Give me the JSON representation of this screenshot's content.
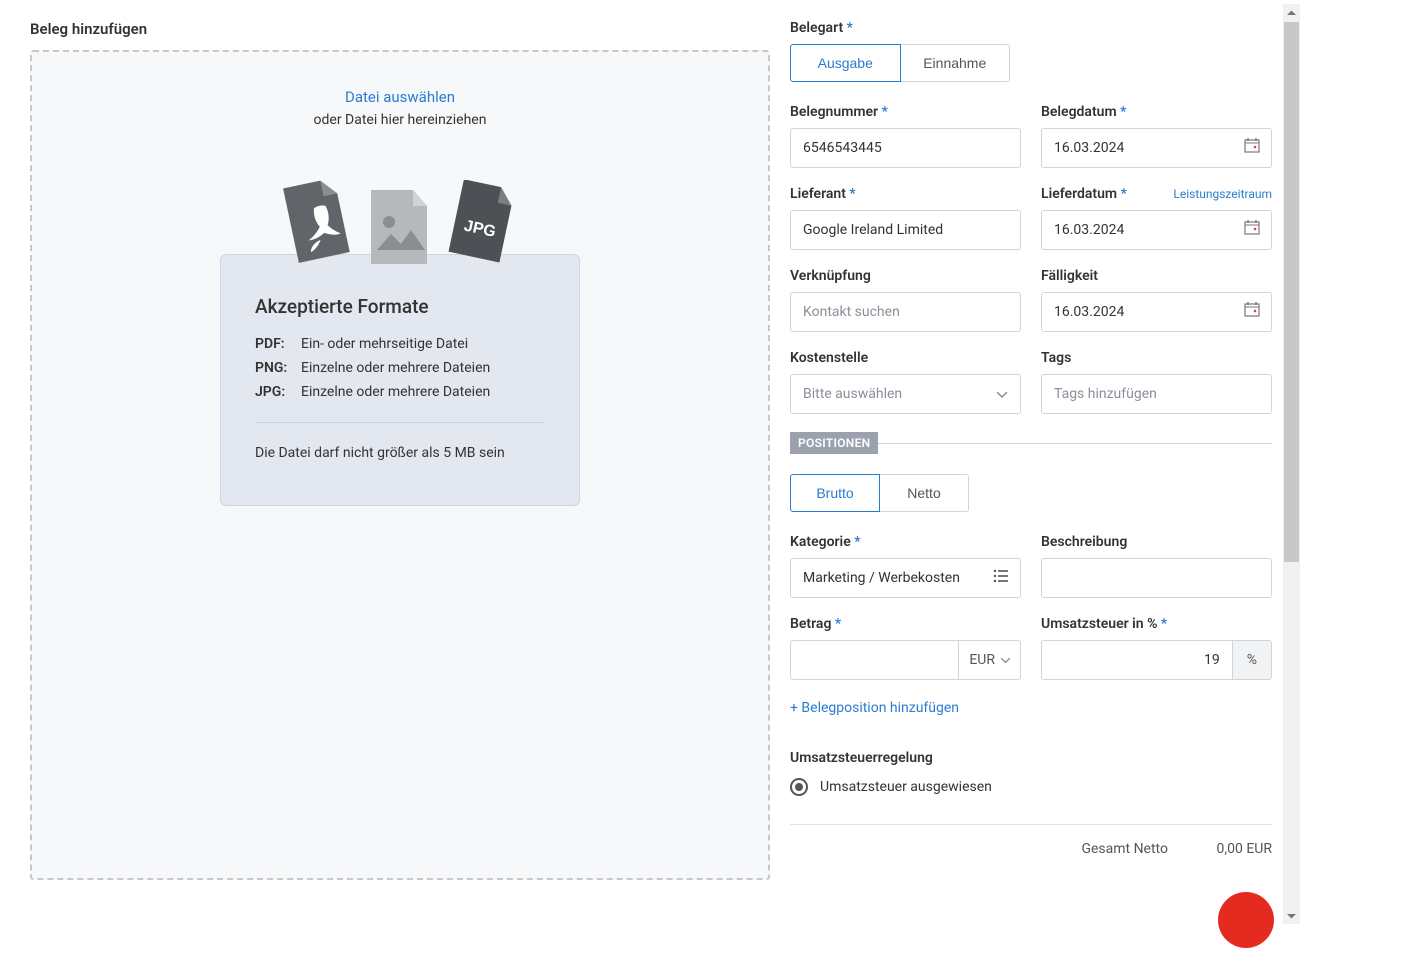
{
  "left": {
    "title": "Beleg hinzufügen",
    "select_file": "Datei auswählen",
    "drag_text": "oder Datei hier hereinziehen",
    "formats_title": "Akzeptierte Formate",
    "formats": [
      {
        "label": "PDF:",
        "desc": "Ein- oder mehrseitige Datei"
      },
      {
        "label": "PNG:",
        "desc": "Einzelne oder mehrere Dateien"
      },
      {
        "label": "JPG:",
        "desc": "Einzelne oder mehrere Dateien"
      }
    ],
    "size_note": "Die Datei darf nicht größer als 5 MB sein"
  },
  "form": {
    "belegart_label": "Belegart",
    "belegart": {
      "ausgabe": "Ausgabe",
      "einnahme": "Einnahme"
    },
    "belegnummer_label": "Belegnummer",
    "belegnummer": "6546543445",
    "belegdatum_label": "Belegdatum",
    "belegdatum": "16.03.2024",
    "lieferant_label": "Lieferant",
    "lieferant": "Google Ireland Limited",
    "lieferdatum_label": "Lieferdatum",
    "lieferdatum": "16.03.2024",
    "leistungszeitraum": "Leistungszeitraum",
    "verknuepfung_label": "Verknüpfung",
    "verknuepfung_ph": "Kontakt suchen",
    "faelligkeit_label": "Fälligkeit",
    "faelligkeit": "16.03.2024",
    "kostenstelle_label": "Kostenstelle",
    "kostenstelle_ph": "Bitte auswählen",
    "tags_label": "Tags",
    "tags_ph": "Tags hinzufügen",
    "positionen_badge": "POSITIONEN",
    "brutto_netto": {
      "brutto": "Brutto",
      "netto": "Netto"
    },
    "kategorie_label": "Kategorie",
    "kategorie": "Marketing / Werbekosten",
    "beschreibung_label": "Beschreibung",
    "betrag_label": "Betrag",
    "betrag_currency": "EUR",
    "ust_label": "Umsatzsteuer in %",
    "ust_value": "19",
    "ust_unit": "%",
    "add_position": "+ Belegposition hinzufügen",
    "ust_regelung_label": "Umsatzsteuerregelung",
    "ust_regelung_option": "Umsatzsteuer ausgewiesen",
    "totals": {
      "netto_label": "Gesamt Netto",
      "netto_value": "0,00 EUR"
    }
  }
}
